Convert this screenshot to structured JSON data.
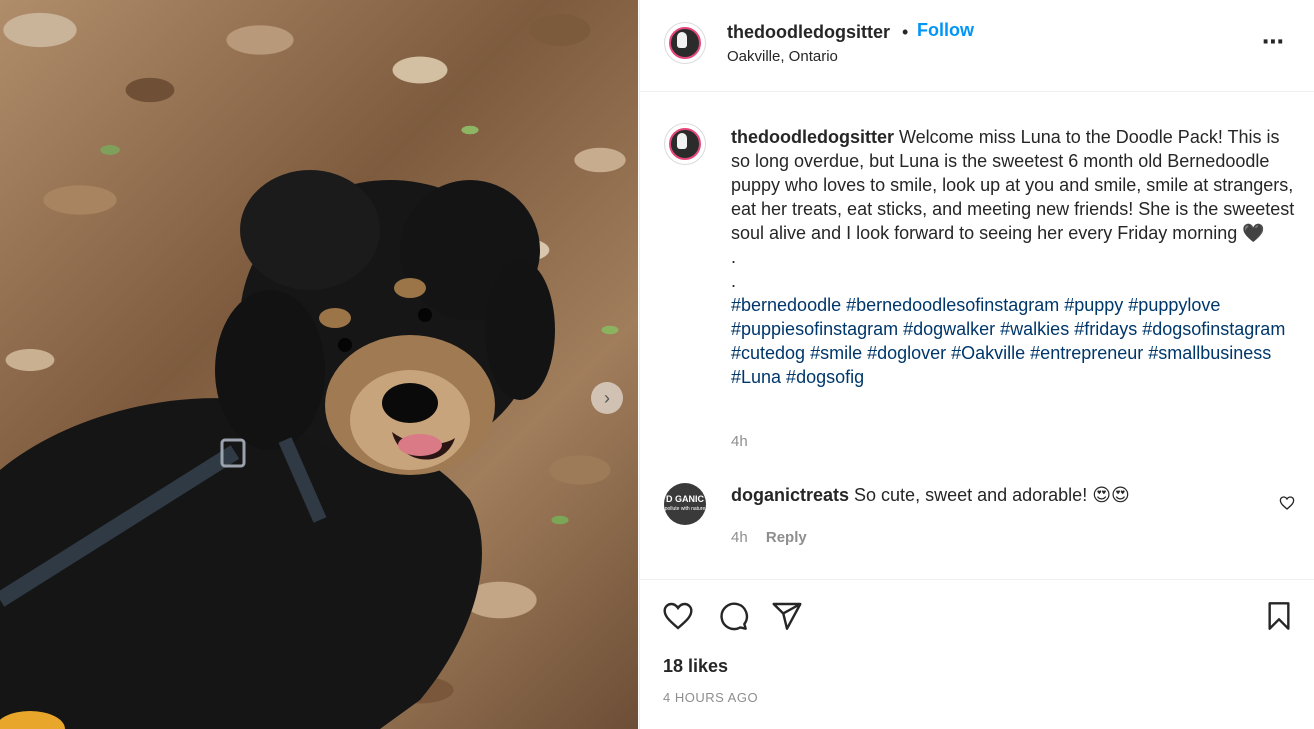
{
  "post": {
    "username": "thedoodledogsitter",
    "separator": "•",
    "follow_label": "Follow",
    "location": "Oakville, Ontario",
    "more_label": "..."
  },
  "photo": {
    "carousel_next_icon": "chevron-right-icon"
  },
  "caption": {
    "username": "thedoodledogsitter",
    "text": " Welcome miss Luna to the Doodle Pack! This is so long overdue, but Luna is the sweetest 6 month old Bernedoodle puppy who loves to smile, look up at you and smile, smile at strangers, eat her treats, eat sticks, and meeting new friends! She is the sweetest soul alive and I look forward to seeing her every Friday morning 🖤",
    "dot1": ".",
    "dot2": ".",
    "hashtags": "#bernedoodle #bernedoodlesofinstagram #puppy #puppylove #puppiesofinstagram #dogwalker #walkies #fridays #dogsofinstagram #cutedog #smile #doglover #Oakville #entrepreneur #smallbusiness #Luna #dogsofig",
    "time": "4h"
  },
  "comment": {
    "username": "doganictreats",
    "text": " So cute, sweet and adorable! 😍😍",
    "time": "4h",
    "reply_label": "Reply",
    "avatar_text": "D GANIC",
    "avatar_subtext": "pollute with nature"
  },
  "actions": {
    "like_icon": "heart-icon",
    "comment_icon": "comment-bubble-icon",
    "share_icon": "paper-plane-icon",
    "save_icon": "bookmark-icon"
  },
  "stats": {
    "likes": "18 likes",
    "time_ago": "4 HOURS AGO"
  },
  "colors": {
    "follow_blue": "#0095f6",
    "hashtag_blue": "#00376b",
    "muted_text": "#8e8e8e",
    "border": "#efefef"
  }
}
